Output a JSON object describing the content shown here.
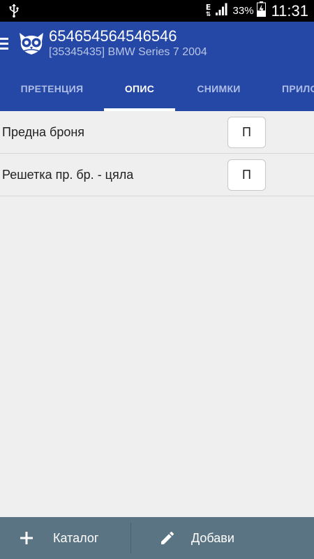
{
  "status_bar": {
    "network_type": "E",
    "battery_percent": "33%",
    "clock": "11:31"
  },
  "app_bar": {
    "title": "654654564546546",
    "subtitle": "[35345435] BMW Series 7 2004",
    "tabs": [
      {
        "label": "ПРЕТЕНЦИЯ",
        "active": false
      },
      {
        "label": "ОПИС",
        "active": true
      },
      {
        "label": "СНИМКИ",
        "active": false
      },
      {
        "label": "ПРИЛОЖЕНИЯ",
        "active": false
      }
    ]
  },
  "items": [
    {
      "label": "Предна броня",
      "button": "П"
    },
    {
      "label": "Решетка пр. бр. - цяла",
      "button": "П"
    }
  ],
  "bottom_bar": {
    "catalog_label": "Каталог",
    "add_label": "Добави"
  },
  "colors": {
    "app_bar": "#2548a6",
    "bottom_bar": "#5b7483",
    "background": "#efefef"
  },
  "icons": {
    "usb": "usb-icon",
    "signal": "signal-icon",
    "battery": "battery-charging-icon",
    "menu": "hamburger-menu-icon",
    "logo": "owl-logo-icon",
    "plus": "plus-icon",
    "pencil": "pencil-icon"
  }
}
